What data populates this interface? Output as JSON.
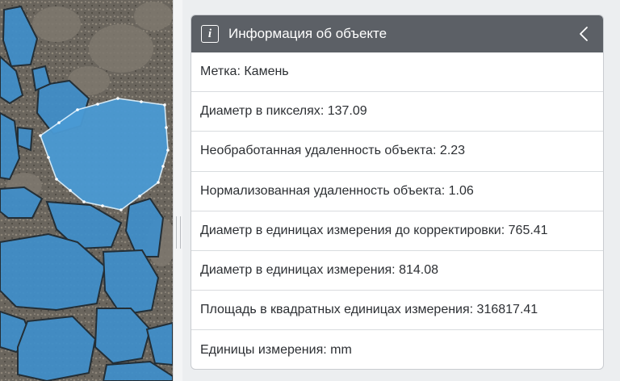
{
  "panel": {
    "title": "Информация об объекте",
    "header_icon": "info-icon",
    "collapse_icon": "chevron-left-icon",
    "header_color": "#5c6066"
  },
  "properties": [
    {
      "label": "Метка",
      "value": "Камень"
    },
    {
      "label": "Диаметр в пикселях",
      "value": "137.09"
    },
    {
      "label": "Необработанная удаленность объекта",
      "value": "2.23"
    },
    {
      "label": "Нормализованная удаленность объекта",
      "value": "1.06"
    },
    {
      "label": "Диаметр в единицах измерения до корректировки",
      "value": "765.41"
    },
    {
      "label": "Диаметр в единицах измерения",
      "value": "814.08"
    },
    {
      "label": "Площадь в квадратных единицах измерения",
      "value": "316817.41"
    },
    {
      "label": "Единицы измерения",
      "value": "mm"
    }
  ],
  "viewer": {
    "segmentation_color": "#3f8fcb",
    "selection_outline_color": "#d8eefc"
  }
}
